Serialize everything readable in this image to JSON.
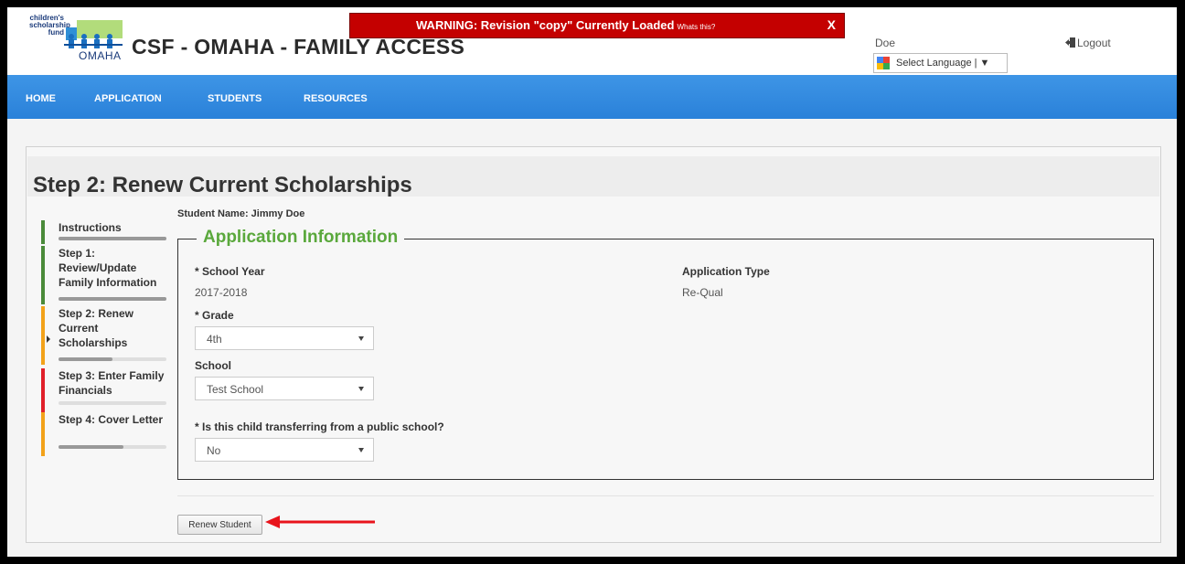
{
  "header": {
    "logo_text": [
      "children's",
      "scholarship",
      "fund"
    ],
    "logo_city": "OMAHA",
    "title": "CSF - OMAHA - FAMILY ACCESS",
    "user_name": "Doe",
    "language_select": "Select Language | ▼",
    "logout_label": "Logout"
  },
  "warning": {
    "text": "WARNING: Revision \"copy\" Currently Loaded",
    "link": "Whats this?",
    "close": "X"
  },
  "nav": {
    "items": [
      "HOME",
      "APPLICATION",
      "STUDENTS",
      "RESOURCES"
    ],
    "active": "APPLICATION"
  },
  "page": {
    "title": "Step 2: Renew Current Scholarships",
    "student_name": "Student Name: Jimmy Doe"
  },
  "steps": [
    {
      "label": "Instructions",
      "status_color": "#4a8a3a",
      "progress": 1.0
    },
    {
      "label": "Step 1: Review/Update Family Information",
      "status_color": "#4a8a3a",
      "progress": 1.0
    },
    {
      "label": "Step 2: Renew Current Scholarships",
      "status_color": "#f2a21a",
      "progress": 0.5
    },
    {
      "label": "Step 3: Enter Family Financials",
      "status_color": "#e0202a",
      "progress": 0.0
    },
    {
      "label": "Step 4: Cover Letter",
      "status_color": "#f2a21a",
      "progress": 0.6
    }
  ],
  "application": {
    "legend": "Application Information",
    "school_year_label": "* School Year",
    "school_year_value": "2017-2018",
    "application_type_label": "Application Type",
    "application_type_value": "Re-Qual",
    "grade_label": "* Grade",
    "grade_value": "4th",
    "school_label": "School",
    "school_value": "Test School",
    "transfer_label": "* Is this child transferring from a public school?",
    "transfer_value": "No"
  },
  "actions": {
    "renew_label": "Renew Student"
  },
  "colors": {
    "nav_blue": "#2a81d9",
    "warning_red": "#c40000",
    "legend_green": "#5aa83c",
    "annotation_red": "#e8141c"
  }
}
